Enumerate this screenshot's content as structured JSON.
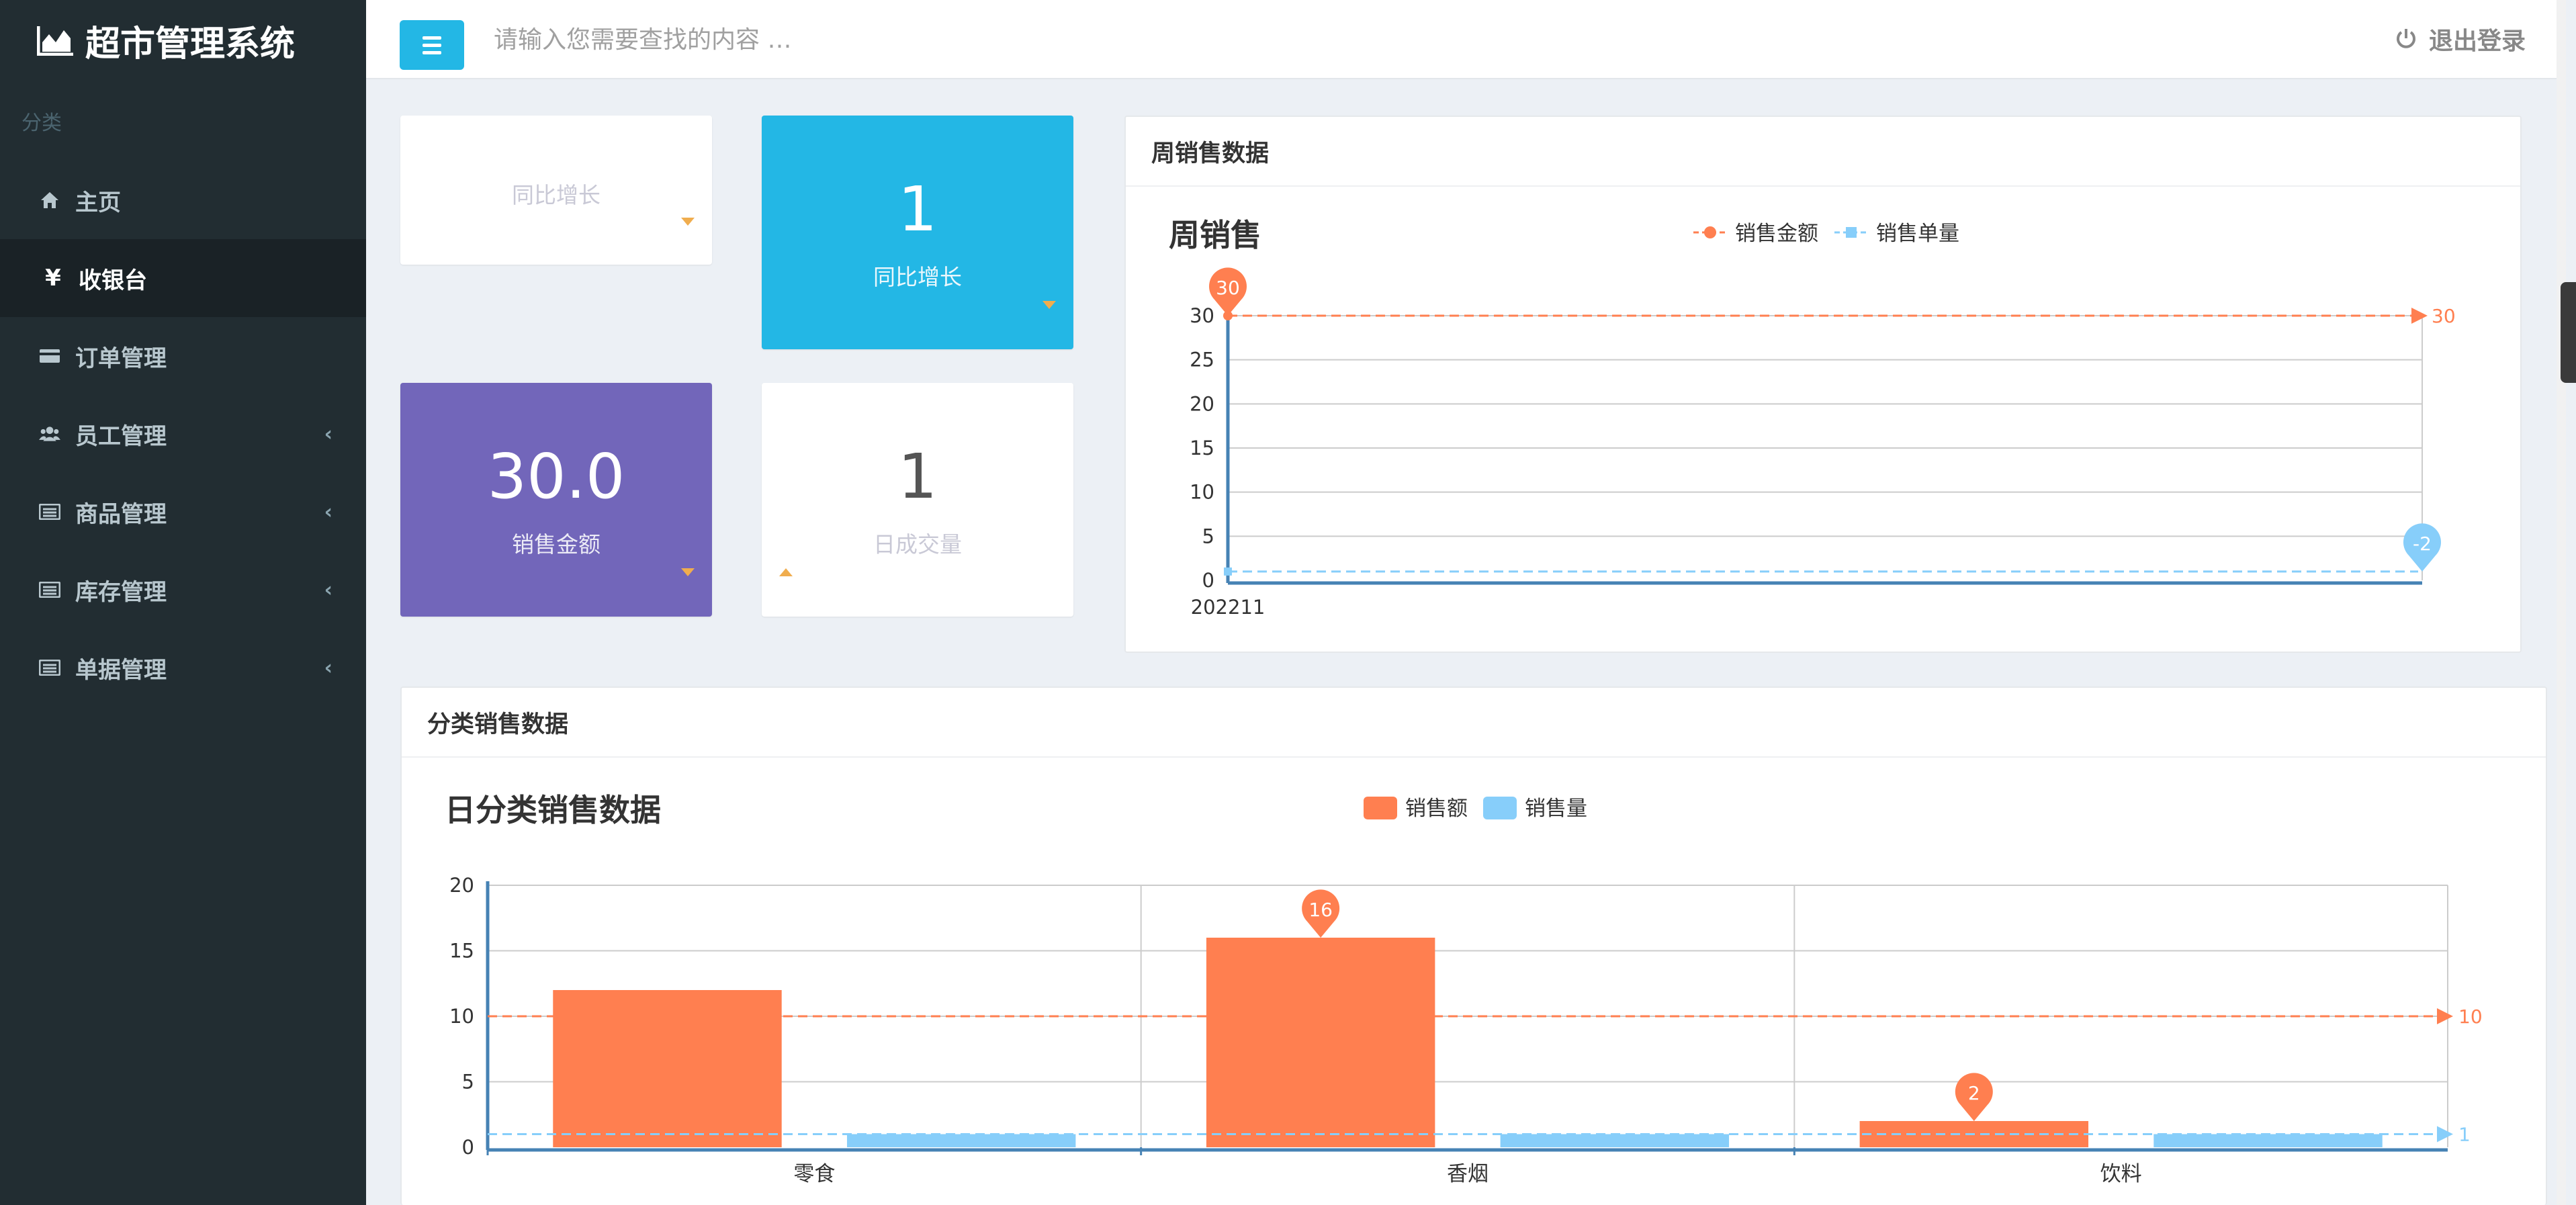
{
  "app": {
    "title": "超市管理系统"
  },
  "sidebar": {
    "section": "分类",
    "items": [
      {
        "label": "主页",
        "icon": "home-icon",
        "active": false,
        "expandable": false
      },
      {
        "label": "收银台",
        "icon": "yen-icon",
        "active": true,
        "expandable": false
      },
      {
        "label": "订单管理",
        "icon": "credit-card-icon",
        "active": false,
        "expandable": false
      },
      {
        "label": "员工管理",
        "icon": "users-icon",
        "active": false,
        "expandable": true
      },
      {
        "label": "商品管理",
        "icon": "list-icon",
        "active": false,
        "expandable": true
      },
      {
        "label": "库存管理",
        "icon": "list-icon",
        "active": false,
        "expandable": true
      },
      {
        "label": "单据管理",
        "icon": "list-icon",
        "active": false,
        "expandable": true
      }
    ]
  },
  "header": {
    "search_placeholder": "请输入您需要查找的内容 …",
    "logout_label": "退出登录"
  },
  "stats": [
    {
      "value": "",
      "label": "同比增长",
      "bg": "#ffffff",
      "trend": "down"
    },
    {
      "value": "1",
      "label": "同比增长",
      "bg": "#23b7e5",
      "trend": "down"
    },
    {
      "value": "30.0",
      "label": "销售金额",
      "bg": "#7266ba",
      "trend": "down"
    },
    {
      "value": "1",
      "label": "日成交量",
      "bg": "#ffffff",
      "trend": "up"
    }
  ],
  "colors": {
    "accent": "#23b7e5",
    "purple": "#7266ba",
    "series_a": "#ff7f50",
    "series_b": "#87cefa",
    "trend": "#f0ad4e"
  },
  "weekly": {
    "panel_title": "周销售数据",
    "chart_title": "周销售",
    "legend": [
      "销售金额",
      "销售单量"
    ]
  },
  "category": {
    "panel_title": "分类销售数据",
    "chart_title": "日分类销售数据",
    "legend": [
      "销售额",
      "销售量"
    ]
  },
  "chart_data": [
    {
      "type": "line",
      "title": "周销售",
      "x": [
        "202211"
      ],
      "ylim": [
        0,
        30
      ],
      "yticks": [
        0,
        5,
        10,
        15,
        20,
        25,
        30
      ],
      "series": [
        {
          "name": "销售金额",
          "values": [
            30
          ],
          "max_label": "30",
          "markline": 30
        },
        {
          "name": "销售单量",
          "values": [
            1
          ],
          "min_label": "-2",
          "markline": 1
        }
      ],
      "grid": true,
      "legend_position": "top-center"
    },
    {
      "type": "bar",
      "title": "日分类销售数据",
      "categories": [
        "零食",
        "香烟",
        "饮料"
      ],
      "ylim": [
        0,
        20
      ],
      "yticks": [
        0,
        5,
        10,
        15,
        20
      ],
      "series": [
        {
          "name": "销售额",
          "values": [
            12,
            16,
            2
          ],
          "max_label": "16",
          "min_label": "2",
          "markline": 10
        },
        {
          "name": "销售量",
          "values": [
            1,
            1,
            1
          ],
          "markline": 1
        }
      ],
      "grid": true,
      "legend_position": "top-center"
    }
  ]
}
